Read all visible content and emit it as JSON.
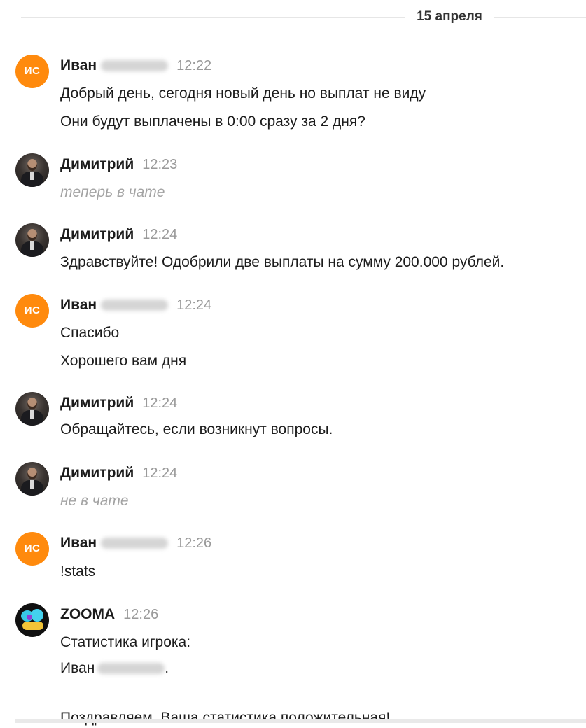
{
  "date_separator": "15 апреля",
  "messages": [
    {
      "author": "Иван",
      "avatar_initials": "ИС",
      "time": "12:22",
      "lines": [
        "Добрый день, сегодня новый день но выплат не виду",
        "Они будут выплачены в 0:00 сразу за 2 дня?"
      ]
    },
    {
      "author": "Димитрий",
      "time": "12:23",
      "status": "теперь в чате"
    },
    {
      "author": "Димитрий",
      "time": "12:24",
      "lines": [
        "Здравствуйте! Одобрили две выплаты на сумму 200.000 рублей."
      ]
    },
    {
      "author": "Иван",
      "avatar_initials": "ИС",
      "time": "12:24",
      "lines": [
        "Спасибо",
        "Хорошего вам дня"
      ]
    },
    {
      "author": "Димитрий",
      "time": "12:24",
      "lines": [
        "Обращайтесь, если возникнут вопросы."
      ]
    },
    {
      "author": "Димитрий",
      "time": "12:24",
      "status": "не в чате"
    },
    {
      "author": "Иван",
      "avatar_initials": "ИС",
      "time": "12:26",
      "lines": [
        "!stats"
      ]
    },
    {
      "author": "ZOOMA",
      "time": "12:26",
      "lines": [
        "Статистика игрока:",
        "Иван",
        ".",
        "Поздравляем. Ваша статистика положительная!"
      ]
    }
  ],
  "colors": {
    "initials_avatar": "#ff8a0d",
    "time_text": "#9a9a9a",
    "status_text": "#a3a3a3"
  }
}
